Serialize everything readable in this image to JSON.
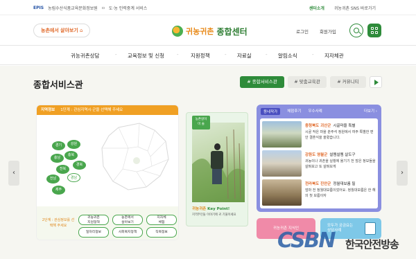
{
  "topbar": {
    "brand": "EPIS",
    "site1": "농림수산식품교육문화정보원",
    "site2": "도·농 인력중계 서비스",
    "center_intro": "센터소개",
    "sns": "귀농귀촌 SNS 바로가기"
  },
  "header": {
    "pill_a": "농촌에서",
    "pill_b": "살아보기",
    "logo_a": "귀농귀촌",
    "logo_b": "종합센터",
    "login": "로그인",
    "signup": "회원가입"
  },
  "gnb": [
    "귀농귀촌상담",
    "교육정보 및 신청",
    "지원정책",
    "자료실",
    "알림소식",
    "지자체관"
  ],
  "main": {
    "title": "종합서비스관",
    "tabs": [
      "# 종합서비스관",
      "# 맞춤교육관",
      "# 커뮤니티"
    ]
  },
  "region_card": {
    "header_label": "지역정보",
    "header_step": "1단계 : 관심지역시·군을 선택해 주세요",
    "provinces": [
      "경기",
      "강원",
      "충남",
      "충북",
      "전북",
      "경북",
      "전남",
      "경남",
      "제주"
    ],
    "step2_label": "2단계 : 관심정보를 선택해 주세요",
    "buttons": [
      [
        "귀농귀촌",
        "지원정책"
      ],
      [
        "농촌에서",
        "살아보기"
      ],
      [
        "지자체",
        "체험"
      ],
      [
        "일자리정보"
      ],
      [
        "사회복지정책"
      ],
      [
        "직목정보"
      ]
    ]
  },
  "keypoint_card": {
    "badge": [
      "농촌살이",
      "미 술"
    ],
    "kp_a": "귀농귀촌",
    "kp_b": "Key Point!",
    "sub": "지역주민들 이야기에 귀 기울이세요"
  },
  "story_card": {
    "tabs": [
      "동네작가",
      "체험후기",
      "우수사례"
    ],
    "more": "더보기",
    "rows": [
      {
        "region": "충청북도 괴산군",
        "title": "시골마을 특별",
        "desc": "시골 작은 마을 춘주석 정원에서 여주 특별한 편안 결혼식을 올렸습니다."
      },
      {
        "region": "강원도 영월군",
        "title": "설렘설렘 살도구",
        "desc": "귀농이나 귀촌을 실행에 옮기기 전 많은 정보들을 살펴보고 또 살펴보게"
      },
      {
        "region": "전라북도 진안군",
        "title": "정월대보름 필",
        "desc": "엄마 전 정월대보름이었어요. 정월대보름은 한 해의 첫 보름이자"
      }
    ]
  },
  "bottom_cards": {
    "pink": "귀농귀촌 지식인",
    "blue_a": "모두가 궁금요는",
    "blue_b": "상담사례"
  },
  "watermark": {
    "logo": "CSBN",
    "text": "한국안전방송"
  },
  "colors": {
    "green": "#2e8b3a",
    "orange": "#f0a024",
    "purple": "#8a8fe0",
    "pink": "#f08aa8",
    "sky": "#7ec8e8"
  }
}
